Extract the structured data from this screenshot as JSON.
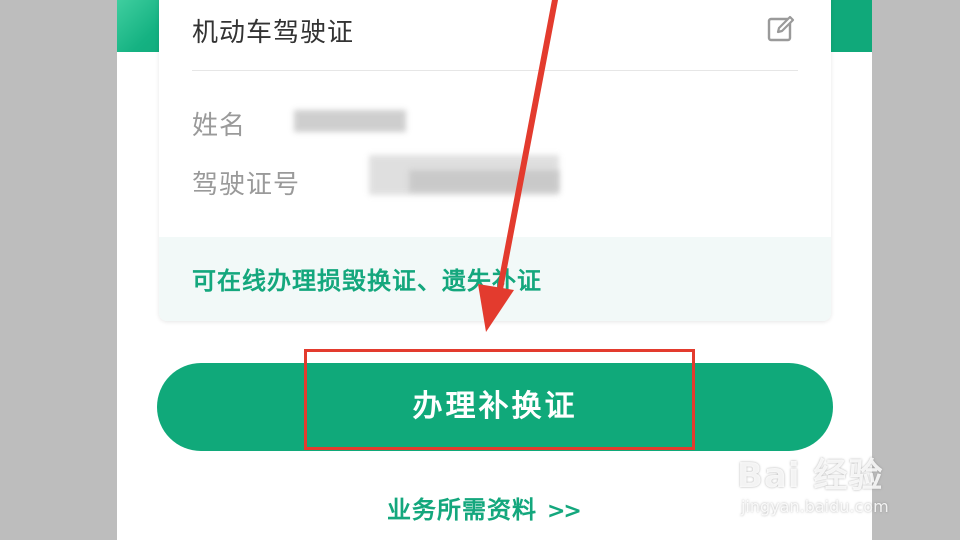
{
  "card": {
    "title": "机动车驾驶证",
    "fields": {
      "name_label": "姓名",
      "license_label": "驾驶证号"
    },
    "footer_note": "可在线办理损毁换证、遗失补证"
  },
  "actions": {
    "main_button": "办理补换证",
    "materials_link": "业务所需资料",
    "materials_arrow": ">>"
  },
  "watermark": {
    "main": "Bai 经验",
    "sub": "jingyan.baidu.com"
  },
  "colors": {
    "brand_green": "#10a97a",
    "text_green": "#14a77d",
    "annotation_red": "#e33b2e"
  },
  "icons": {
    "edit": "edit-icon"
  }
}
